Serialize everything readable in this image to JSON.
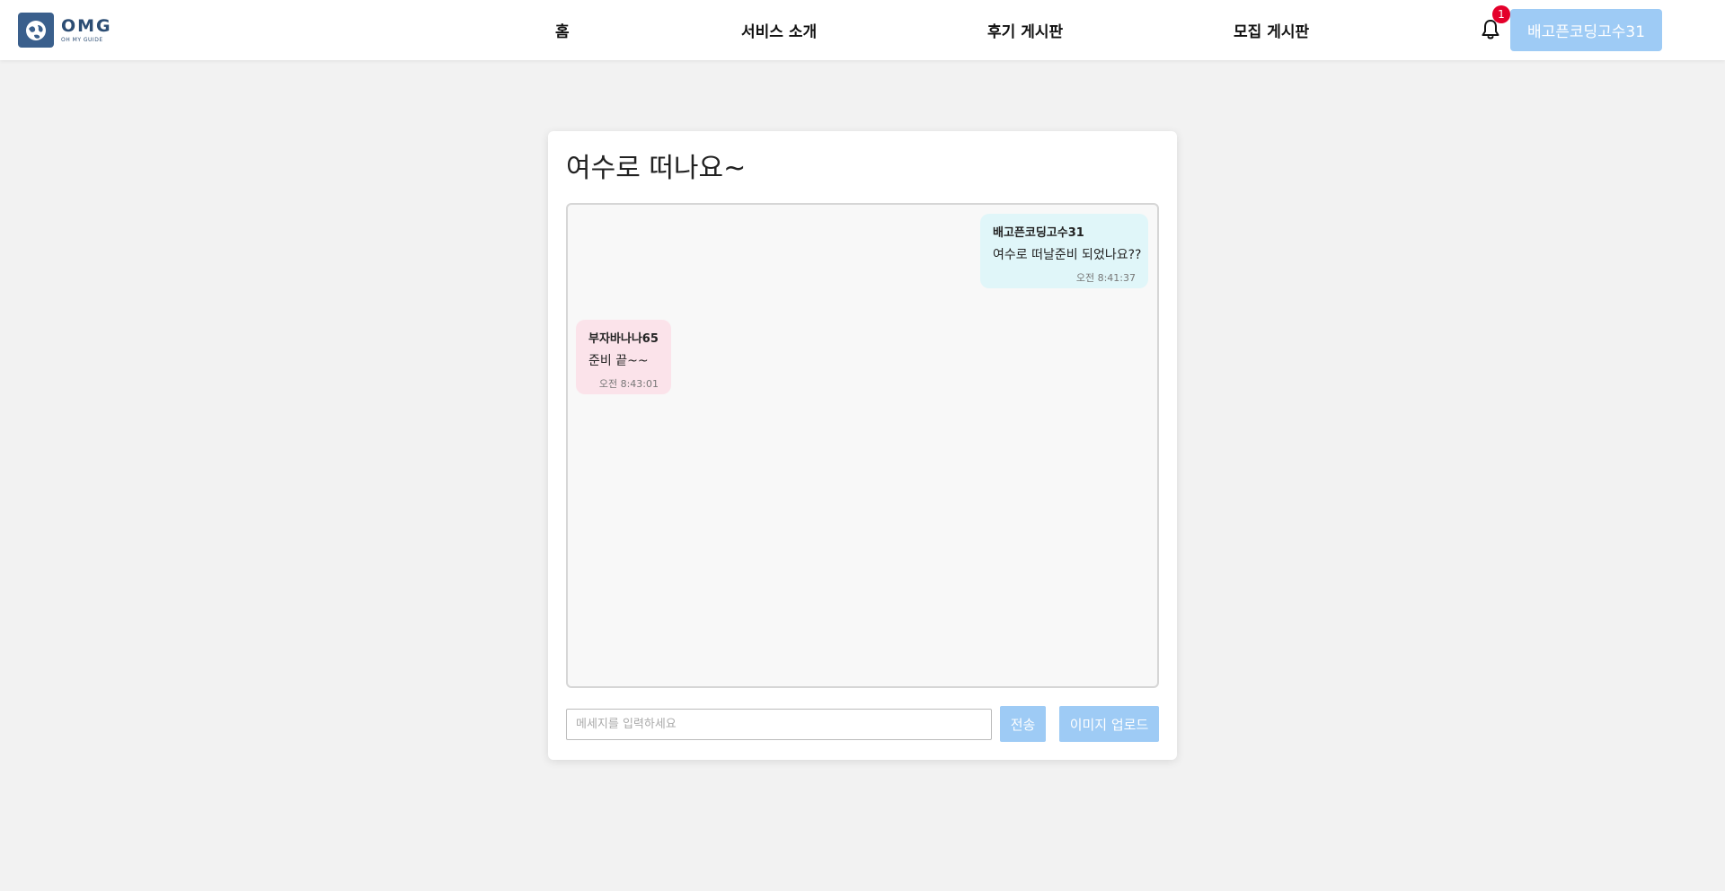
{
  "header": {
    "logo": {
      "main": "OMG",
      "sub": "OH MY GUIDE"
    },
    "nav": [
      {
        "label": "홈"
      },
      {
        "label": "서비스 소개"
      },
      {
        "label": "후기 게시판"
      },
      {
        "label": "모집 게시판"
      }
    ],
    "notification_count": "1",
    "user_label": "배고픈코딩고수31",
    "accent_color": "#9ecbf5"
  },
  "chat": {
    "title": "여수로 떠나요~",
    "messages": [
      {
        "sender": "배고픈코딩고수31",
        "text": "여수로 떠날준비 되었나요??",
        "time": "오전 8:41:37",
        "mine": true,
        "bubble_color": "#e0f6f9"
      },
      {
        "sender": "부자바나나65",
        "text": "준비 끝~~",
        "time": "오전 8:43:01",
        "mine": false,
        "bubble_color": "#fbe3ea"
      }
    ],
    "input": {
      "placeholder": "메세지를 입력하세요",
      "value": ""
    },
    "send_label": "전송",
    "upload_label": "이미지 업로드"
  }
}
